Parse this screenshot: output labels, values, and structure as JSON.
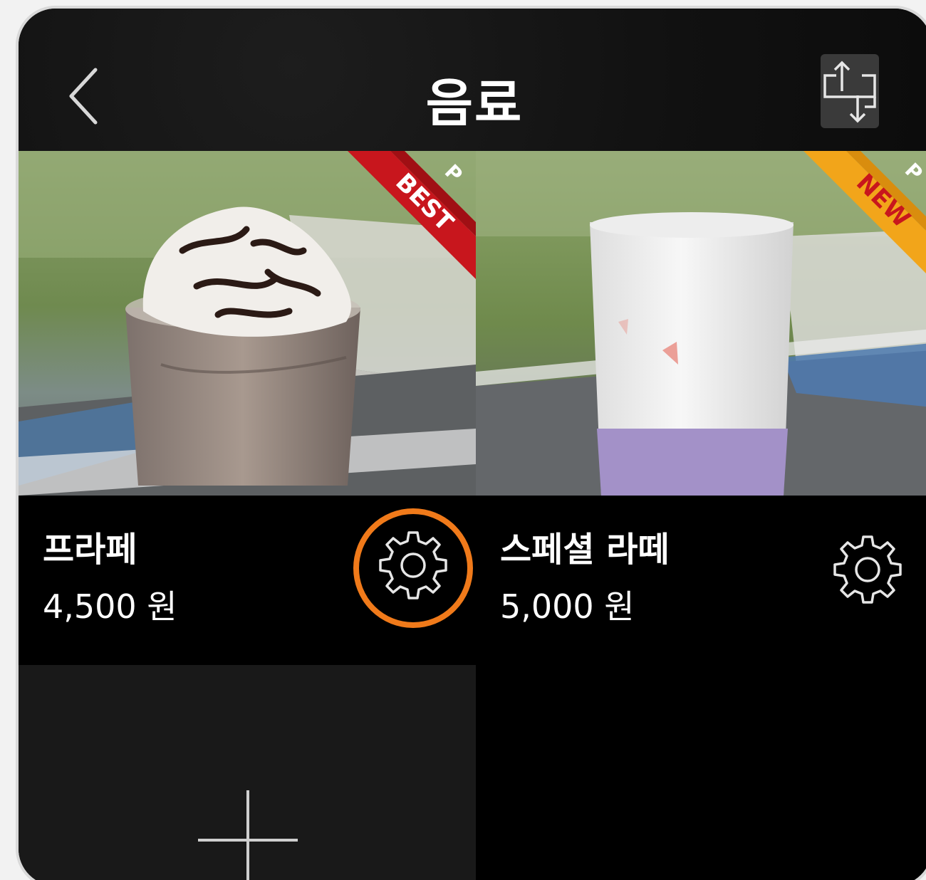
{
  "header": {
    "title": "음료",
    "back_icon": "chevron-left-icon",
    "sort_icon": "swap-order-icon"
  },
  "products": [
    {
      "name": "프라페",
      "price": "4,500 원",
      "badge": "BEST",
      "badge_letter": "P",
      "badge_color": "#c8161d",
      "settings_icon": "gear-icon"
    },
    {
      "name": "스페셜 라떼",
      "price": "5,000 원",
      "badge": "NEW",
      "badge_letter": "P",
      "badge_color": "#f2a51a",
      "settings_icon": "gear-icon"
    }
  ],
  "add_tile": {
    "icon": "plus-icon"
  },
  "colors": {
    "highlight": "#f07a1a",
    "background": "#000000"
  }
}
